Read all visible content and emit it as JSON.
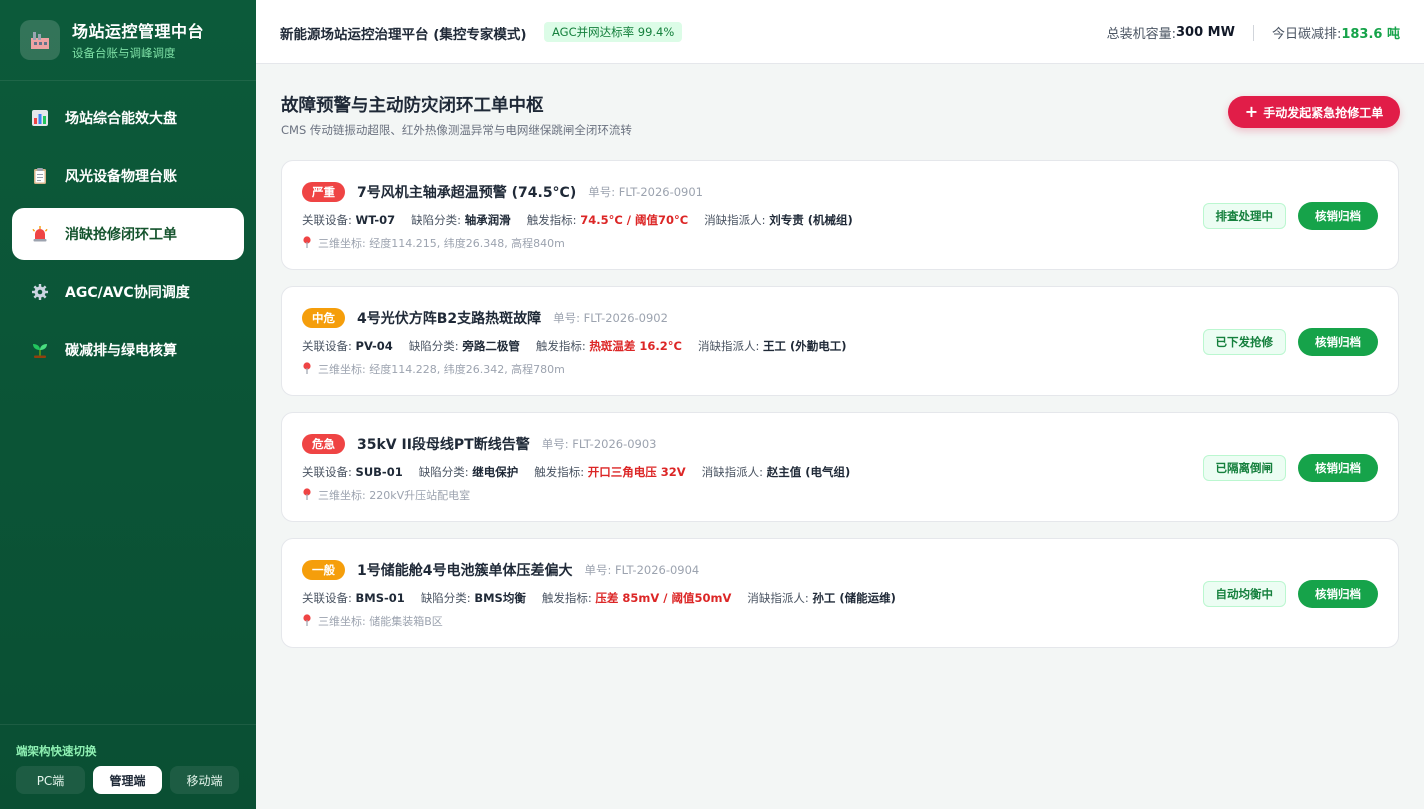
{
  "brand": {
    "title": "场站运控管理中台",
    "subtitle": "设备台账与调峰调度"
  },
  "nav": [
    {
      "label": "场站综合能效大盘",
      "icon": "bar-chart-icon"
    },
    {
      "label": "风光设备物理台账",
      "icon": "clipboard-icon"
    },
    {
      "label": "消缺抢修闭环工单",
      "icon": "siren-icon",
      "active": true
    },
    {
      "label": "AGC/AVC协同调度",
      "icon": "gear-icon"
    },
    {
      "label": "碳减排与绿电核算",
      "icon": "seedling-icon"
    }
  ],
  "switch": {
    "title": "端架构快速切换",
    "buttons": [
      "PC端",
      "管理端",
      "移动端"
    ],
    "active": "管理端"
  },
  "topbar": {
    "title": "新能源场站运控治理平台 (集控专家模式)",
    "badge": "AGC并网达标率 99.4%",
    "capacity_label": "总装机容量:",
    "capacity_value": "300 MW",
    "carbon_label": "今日碳减排:",
    "carbon_value": "183.6 吨"
  },
  "page": {
    "title": "故障预警与主动防灾闭环工单中枢",
    "subtitle": "CMS 传动链振动超限、红外热像测温异常与电网继保跳闸全闭环流转",
    "emergency_button": "手动发起紧急抢修工单"
  },
  "labels": {
    "device": "关联设备:",
    "category": "缺陷分类:",
    "trigger": "触发指标:",
    "assignee": "消缺指派人:",
    "coord": "三维坐标:",
    "archive": "核销归档"
  },
  "colors": {
    "严重": "#ef4444",
    "中危": "#f59e0b",
    "危急": "#ef4444",
    "一般": "#f59e0b"
  },
  "tickets": [
    {
      "level": "严重",
      "level_color": "#ef4444",
      "title": "7号风机主轴承超温预警 (74.5°C)",
      "no": "单号: FLT-2026-0901",
      "device": "WT-07",
      "category": "轴承润滑",
      "trigger": "74.5°C / 阈值70°C",
      "assignee": "刘专责 (机械组)",
      "coord": "经度114.215, 纬度26.348, 高程840m",
      "status": "排查处理中"
    },
    {
      "level": "中危",
      "level_color": "#f59e0b",
      "title": "4号光伏方阵B2支路热斑故障",
      "no": "单号: FLT-2026-0902",
      "device": "PV-04",
      "category": "旁路二极管",
      "trigger": "热斑温差 16.2°C",
      "assignee": "王工 (外勤电工)",
      "coord": "经度114.228, 纬度26.342, 高程780m",
      "status": "已下发抢修"
    },
    {
      "level": "危急",
      "level_color": "#ef4444",
      "title": "35kV II段母线PT断线告警",
      "no": "单号: FLT-2026-0903",
      "device": "SUB-01",
      "category": "继电保护",
      "trigger": "开口三角电压 32V",
      "assignee": "赵主值 (电气组)",
      "coord": "220kV升压站配电室",
      "status": "已隔离倒闸"
    },
    {
      "level": "一般",
      "level_color": "#f59e0b",
      "title": "1号储能舱4号电池簇单体压差偏大",
      "no": "单号: FLT-2026-0904",
      "device": "BMS-01",
      "category": "BMS均衡",
      "trigger": "压差 85mV / 阈值50mV",
      "assignee": "孙工 (储能运维)",
      "coord": "储能集装箱B区",
      "status": "自动均衡中"
    }
  ]
}
